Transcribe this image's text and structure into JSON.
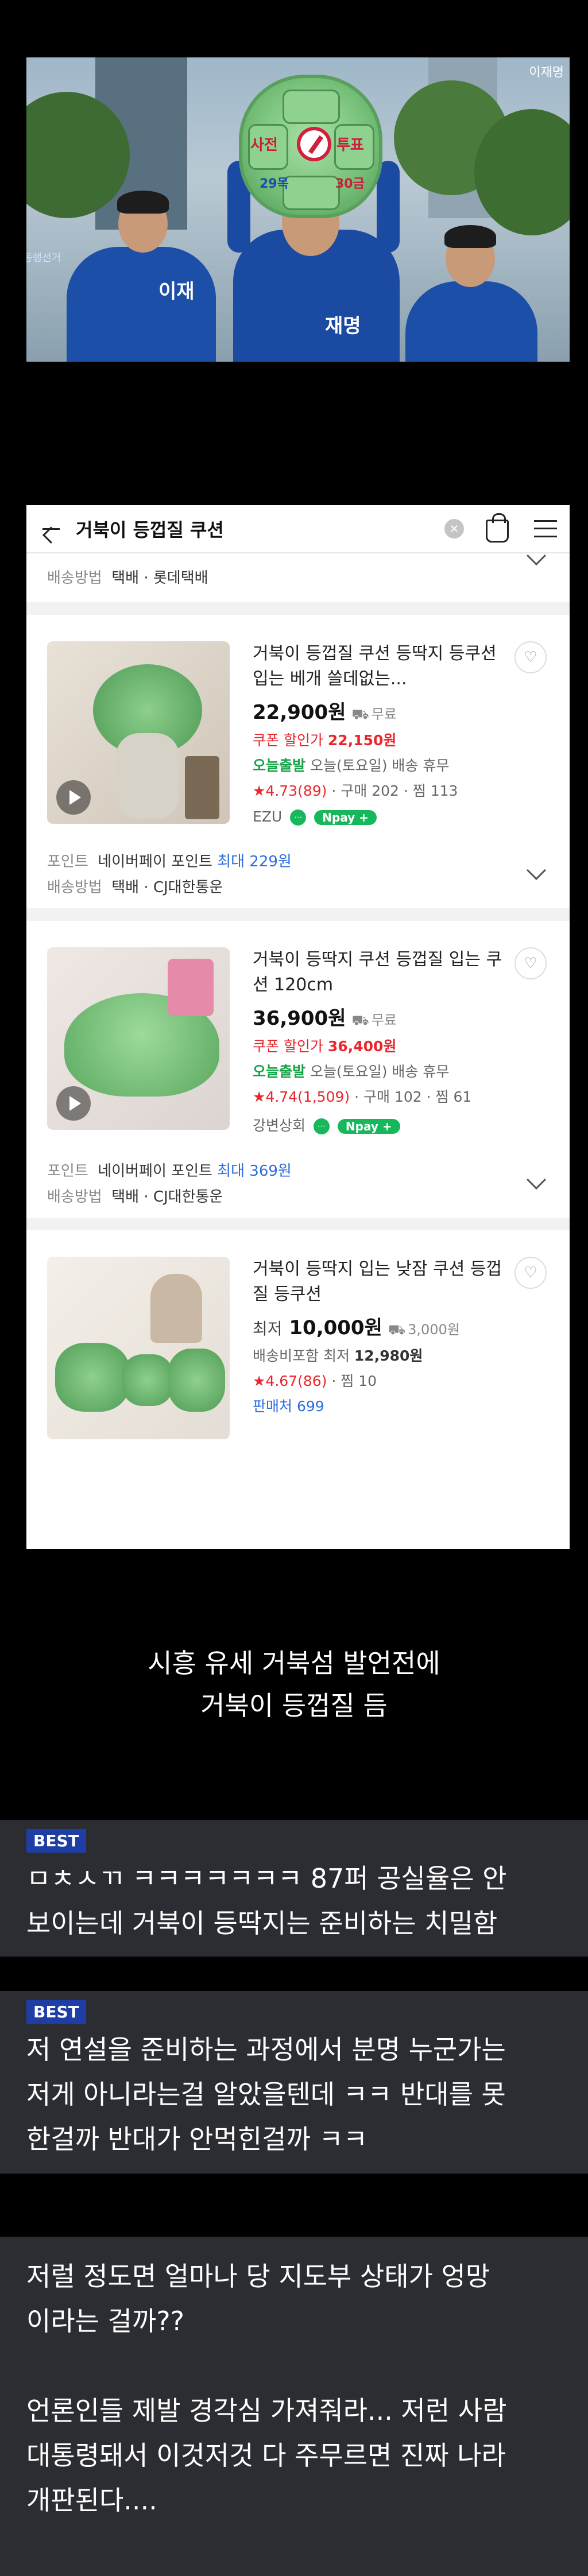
{
  "photo": {
    "watermark": "이재명",
    "shell_words": [
      "사전",
      "투표",
      "29목",
      "30금"
    ],
    "side_text_left": "동행선거"
  },
  "shop": {
    "search_title": "거북이 등껍질 쿠션",
    "top_meta_label": "배송방법",
    "top_meta_value": "택배 · 롯데택배",
    "products": [
      {
        "name": "거북이 등껍질 쿠션 등딱지 등쿠션 입는 베개 쓸데없는...",
        "price": "22,900원",
        "shipping": "무료",
        "coupon_label": "쿠폰 할인가",
        "coupon_price": "22,150원",
        "delivery_label": "오늘출발",
        "delivery_text": "오늘(토요일) 배송 휴무",
        "rating": "★4.73(89)",
        "stats": "· 구매 202 · 찜 113",
        "seller": "EZU",
        "npay": "Npay +",
        "point_label": "포인트",
        "point_text": "네이버페이 포인트",
        "point_max": "최대 229원",
        "ship_label": "배송방법",
        "ship_text": "택배 · CJ대한통운"
      },
      {
        "name": "거북이 등딱지 쿠션 등껍질 입는 쿠션 120cm",
        "price": "36,900원",
        "shipping": "무료",
        "coupon_label": "쿠폰 할인가",
        "coupon_price": "36,400원",
        "delivery_label": "오늘출발",
        "delivery_text": "오늘(토요일) 배송 휴무",
        "rating": "★4.74(1,509)",
        "stats": "· 구매 102 · 찜 61",
        "seller": "강변상회",
        "npay": "Npay +",
        "point_label": "포인트",
        "point_text": "네이버페이 포인트",
        "point_max": "최대 369원",
        "ship_label": "배송방법",
        "ship_text": "택배 · CJ대한통운"
      },
      {
        "name": "거북이 등딱지 입는 낮잠 쿠션 등껍질 등쿠션",
        "price_prefix": "최저",
        "price": "10,000원",
        "shipping": "3,000원",
        "ship_incl_label": "배송비포함 최저",
        "ship_incl_price": "12,980원",
        "rating": "★4.67(86)",
        "stats": "· 찜 10",
        "sellers": "판매처 699"
      }
    ]
  },
  "caption": {
    "line1": "시흥 유세 거북섬 발언전에",
    "line2": "거북이 등껍질 듬"
  },
  "comments": [
    {
      "badge": "BEST",
      "lines": [
        "ㅁㅊㅅㄲ ㅋㅋㅋㅋㅋㅋㅋ 87퍼 공실율은 안",
        "보이는데 거북이 등딱지는 준비하는 치밀함"
      ]
    },
    {
      "badge": "BEST",
      "lines": [
        "저 연설을 준비하는 과정에서 분명 누군가는",
        "저게 아니라는걸 알았을텐데 ㅋㅋ 반대를 못",
        "한걸까 반대가 안먹힌걸까 ㅋㅋ"
      ]
    },
    {
      "badge": "",
      "lines": [
        "저럴 정도면 얼마나 당 지도부 상태가 엉망",
        "이라는 걸까??",
        "",
        "언론인들 제발 경각심 가져줘라... 저런 사람",
        "대통령돼서 이것저것 다 주무르면 진짜 나라",
        "개판된다...."
      ]
    }
  ]
}
